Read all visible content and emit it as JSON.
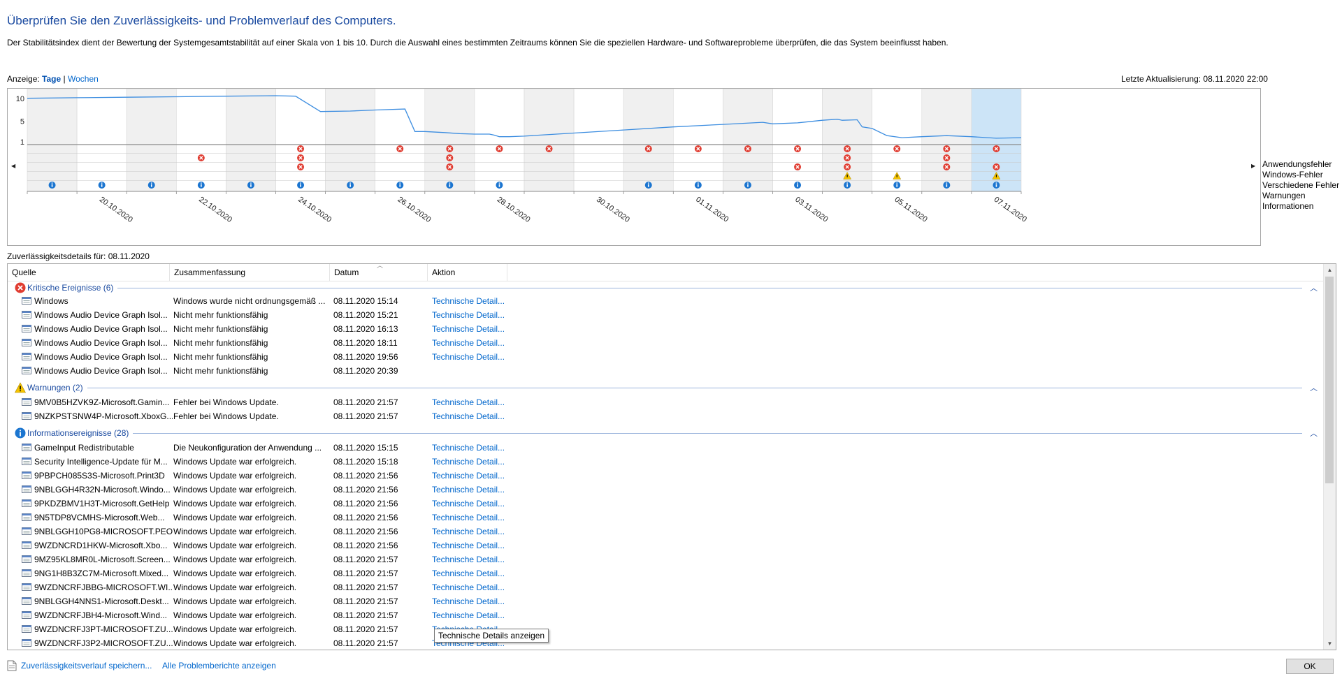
{
  "page": {
    "title": "Überprüfen Sie den Zuverlässigkeits- und Problemverlauf des Computers.",
    "description": "Der Stabilitätsindex dient der Bewertung der Systemgesamtstabilität auf einer Skala von 1 bis 10. Durch die Auswahl eines bestimmten Zeitraums können Sie die speziellen Hardware- und Softwareprobleme überprüfen, die das System beeinflusst haben.",
    "view_label": "Anzeige:",
    "view_days": "Tage",
    "view_separator": "|",
    "view_weeks": "Wochen",
    "last_update": "Letzte Aktualisierung: 08.11.2020 22:00"
  },
  "chart_data": {
    "type": "line",
    "title": "",
    "y_ticks": [
      "10",
      "5",
      "1"
    ],
    "ylim": [
      1,
      10
    ],
    "day_count": 20,
    "selected_day_index": 19,
    "date_labels": [
      {
        "day_index": 1,
        "label": "20.10.2020"
      },
      {
        "day_index": 3,
        "label": "22.10.2020"
      },
      {
        "day_index": 5,
        "label": "24.10.2020"
      },
      {
        "day_index": 7,
        "label": "26.10.2020"
      },
      {
        "day_index": 9,
        "label": "28.10.2020"
      },
      {
        "day_index": 11,
        "label": "30.10.2020"
      },
      {
        "day_index": 13,
        "label": "01.11.2020"
      },
      {
        "day_index": 15,
        "label": "03.11.2020"
      },
      {
        "day_index": 17,
        "label": "05.11.2020"
      },
      {
        "day_index": 19,
        "label": "07.11.2020"
      }
    ],
    "stability_series": [
      [
        0,
        9.5
      ],
      [
        1,
        9.6
      ],
      [
        2,
        9.7
      ],
      [
        3,
        9.8
      ],
      [
        4,
        9.9
      ],
      [
        5,
        10.0
      ],
      [
        5.4,
        9.9
      ],
      [
        5.9,
        6.9
      ],
      [
        6.5,
        7.0
      ],
      [
        7,
        7.2
      ],
      [
        7.6,
        7.4
      ],
      [
        7.8,
        3.0
      ],
      [
        8,
        3.0
      ],
      [
        8.4,
        2.8
      ],
      [
        8.7,
        2.6
      ],
      [
        9,
        2.5
      ],
      [
        9.3,
        2.5
      ],
      [
        9.4,
        2.3
      ],
      [
        9.5,
        2.0
      ],
      [
        9.7,
        2.0
      ],
      [
        10,
        2.1
      ],
      [
        10.3,
        2.3
      ],
      [
        11,
        2.7
      ],
      [
        12,
        3.3
      ],
      [
        13,
        3.9
      ],
      [
        14,
        4.4
      ],
      [
        14.8,
        4.8
      ],
      [
        15,
        4.5
      ],
      [
        15.5,
        4.7
      ],
      [
        16,
        5.2
      ],
      [
        16.3,
        5.4
      ],
      [
        16.4,
        5.2
      ],
      [
        16.7,
        5.3
      ],
      [
        16.8,
        3.9
      ],
      [
        17,
        3.6
      ],
      [
        17.3,
        2.2
      ],
      [
        17.6,
        1.8
      ],
      [
        18,
        2.0
      ],
      [
        18.5,
        2.2
      ],
      [
        19,
        2.0
      ],
      [
        19.5,
        1.7
      ],
      [
        20,
        1.8
      ]
    ],
    "rows": [
      "Anwendungsfehler",
      "Windows-Fehler",
      "Verschiedene Fehler",
      "Warnungen",
      "Informationen"
    ],
    "markers": [
      {
        "row": 0,
        "type": "error",
        "days": [
          5,
          7,
          8,
          9,
          10,
          12,
          13,
          14,
          15,
          16,
          17,
          18,
          19
        ]
      },
      {
        "row": 1,
        "type": "error",
        "days": [
          3,
          5,
          8,
          16,
          18
        ]
      },
      {
        "row": 2,
        "type": "error",
        "days": [
          5,
          8,
          15,
          16,
          18,
          19
        ]
      },
      {
        "row": 3,
        "type": "warning",
        "days": [
          16,
          17,
          19
        ]
      },
      {
        "row": 4,
        "type": "info",
        "days": [
          0,
          1,
          2,
          3,
          4,
          5,
          6,
          7,
          8,
          9,
          12,
          13,
          14,
          15,
          16,
          17,
          18,
          19
        ]
      }
    ]
  },
  "details": {
    "label": "Zuverlässigkeitsdetails für: 08.11.2020",
    "columns": {
      "source": "Quelle",
      "summary": "Zusammenfassung",
      "date": "Datum",
      "action": "Aktion"
    },
    "tooltip": "Technische Details anzeigen",
    "groups": [
      {
        "kind": "error",
        "title": "Kritische Ereignisse (6)",
        "rows": [
          {
            "source": "Windows",
            "summary": "Windows wurde nicht ordnungsgemäß ...",
            "date": "08.11.2020 15:14",
            "action": "Technische Detail..."
          },
          {
            "source": "Windows Audio Device Graph Isol...",
            "summary": "Nicht mehr funktionsfähig",
            "date": "08.11.2020 15:21",
            "action": "Technische Detail..."
          },
          {
            "source": "Windows Audio Device Graph Isol...",
            "summary": "Nicht mehr funktionsfähig",
            "date": "08.11.2020 16:13",
            "action": "Technische Detail..."
          },
          {
            "source": "Windows Audio Device Graph Isol...",
            "summary": "Nicht mehr funktionsfähig",
            "date": "08.11.2020 18:11",
            "action": "Technische Detail..."
          },
          {
            "source": "Windows Audio Device Graph Isol...",
            "summary": "Nicht mehr funktionsfähig",
            "date": "08.11.2020 19:56",
            "action": "Technische Detail..."
          },
          {
            "source": "Windows Audio Device Graph Isol...",
            "summary": "Nicht mehr funktionsfähig",
            "date": "08.11.2020 20:39",
            "action": ""
          }
        ]
      },
      {
        "kind": "warning",
        "title": "Warnungen (2)",
        "rows": [
          {
            "source": "9MV0B5HZVK9Z-Microsoft.Gamin...",
            "summary": "Fehler bei Windows Update.",
            "date": "08.11.2020 21:57",
            "action": "Technische Detail..."
          },
          {
            "source": "9NZKPSTSNW4P-Microsoft.XboxG...",
            "summary": "Fehler bei Windows Update.",
            "date": "08.11.2020 21:57",
            "action": "Technische Detail..."
          }
        ]
      },
      {
        "kind": "info",
        "title": "Informationsereignisse (28)",
        "rows": [
          {
            "source": "GameInput Redistributable",
            "summary": "Die Neukonfiguration der Anwendung ...",
            "date": "08.11.2020 15:15",
            "action": "Technische Detail..."
          },
          {
            "source": "Security Intelligence-Update für M...",
            "summary": "Windows Update war erfolgreich.",
            "date": "08.11.2020 15:18",
            "action": "Technische Detail..."
          },
          {
            "source": "9PBPCH085S3S-Microsoft.Print3D",
            "summary": "Windows Update war erfolgreich.",
            "date": "08.11.2020 21:56",
            "action": "Technische Detail..."
          },
          {
            "source": "9NBLGGH4R32N-Microsoft.Windo...",
            "summary": "Windows Update war erfolgreich.",
            "date": "08.11.2020 21:56",
            "action": "Technische Detail..."
          },
          {
            "source": "9PKDZBMV1H3T-Microsoft.GetHelp",
            "summary": "Windows Update war erfolgreich.",
            "date": "08.11.2020 21:56",
            "action": "Technische Detail..."
          },
          {
            "source": "9N5TDP8VCMHS-Microsoft.Web...",
            "summary": "Windows Update war erfolgreich.",
            "date": "08.11.2020 21:56",
            "action": "Technische Detail..."
          },
          {
            "source": "9NBLGGH10PG8-MICROSOFT.PEO...",
            "summary": "Windows Update war erfolgreich.",
            "date": "08.11.2020 21:56",
            "action": "Technische Detail..."
          },
          {
            "source": "9WZDNCRD1HKW-Microsoft.Xbo...",
            "summary": "Windows Update war erfolgreich.",
            "date": "08.11.2020 21:56",
            "action": "Technische Detail..."
          },
          {
            "source": "9MZ95KL8MR0L-Microsoft.Screen...",
            "summary": "Windows Update war erfolgreich.",
            "date": "08.11.2020 21:57",
            "action": "Technische Detail..."
          },
          {
            "source": "9NG1H8B3ZC7M-Microsoft.Mixed...",
            "summary": "Windows Update war erfolgreich.",
            "date": "08.11.2020 21:57",
            "action": "Technische Detail..."
          },
          {
            "source": "9WZDNCRFJBBG-MICROSOFT.WI...",
            "summary": "Windows Update war erfolgreich.",
            "date": "08.11.2020 21:57",
            "action": "Technische Detail..."
          },
          {
            "source": "9NBLGGH4NNS1-Microsoft.Deskt...",
            "summary": "Windows Update war erfolgreich.",
            "date": "08.11.2020 21:57",
            "action": "Technische Detail..."
          },
          {
            "source": "9WZDNCRFJBH4-Microsoft.Wind...",
            "summary": "Windows Update war erfolgreich.",
            "date": "08.11.2020 21:57",
            "action": "Technische Detail..."
          },
          {
            "source": "9WZDNCRFJ3PT-MICROSOFT.ZU...",
            "summary": "Windows Update war erfolgreich.",
            "date": "08.11.2020 21:57",
            "action": "Technische Detail..."
          },
          {
            "source": "9WZDNCRFJ3P2-MICROSOFT.ZU...",
            "summary": "Windows Update war erfolgreich.",
            "date": "08.11.2020 21:57",
            "action": "Technische Detail..."
          }
        ]
      }
    ]
  },
  "footer": {
    "save_link": "Zuverlässigkeitsverlauf speichern...",
    "reports_link": "Alle Problemberichte anzeigen",
    "ok_label": "OK"
  },
  "colors": {
    "accent": "#1a4aa0",
    "link": "#0066cc",
    "line": "#3c8de0",
    "error": "#e03c31",
    "warning": "#f5c400",
    "info": "#1b75d0",
    "selected_column": "#cce4f7",
    "shaded_column": "#f0f0f0"
  }
}
